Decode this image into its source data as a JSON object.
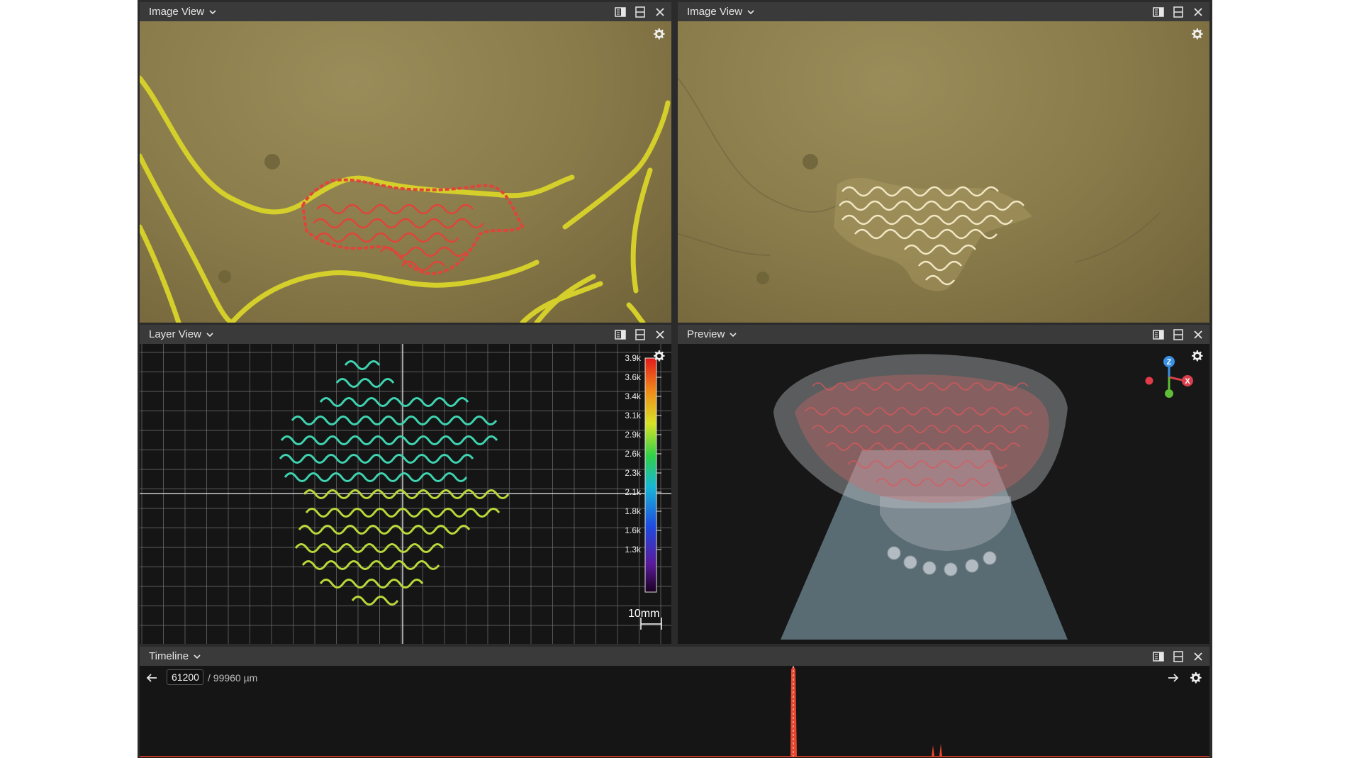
{
  "panels": {
    "image_view_1": {
      "title": "Image View"
    },
    "image_view_2": {
      "title": "Image View"
    },
    "layer_view": {
      "title": "Layer View",
      "colorbar_ticks": [
        "3.9k",
        "3.6k",
        "3.4k",
        "3.1k",
        "2.9k",
        "2.6k",
        "2.3k",
        "2.1k",
        "1.8k",
        "1.6k",
        "1.3k"
      ],
      "scale_bar": "10mm"
    },
    "preview": {
      "title": "Preview",
      "axes": {
        "z": "Z",
        "x": "X"
      }
    },
    "timeline": {
      "title": "Timeline",
      "current_layer": "61200",
      "total_layers": "/ 99960 µm"
    }
  },
  "header_icons": [
    "split-vertical-icon",
    "split-horizontal-icon",
    "close-icon"
  ],
  "colors": {
    "panel_header": "#3a3a3a",
    "panel_bg": "#1b1b1b",
    "yellow_overlay": "#d4cf2a",
    "red_overlay": "#e0443a",
    "timeline_spike": "#e8462e"
  }
}
